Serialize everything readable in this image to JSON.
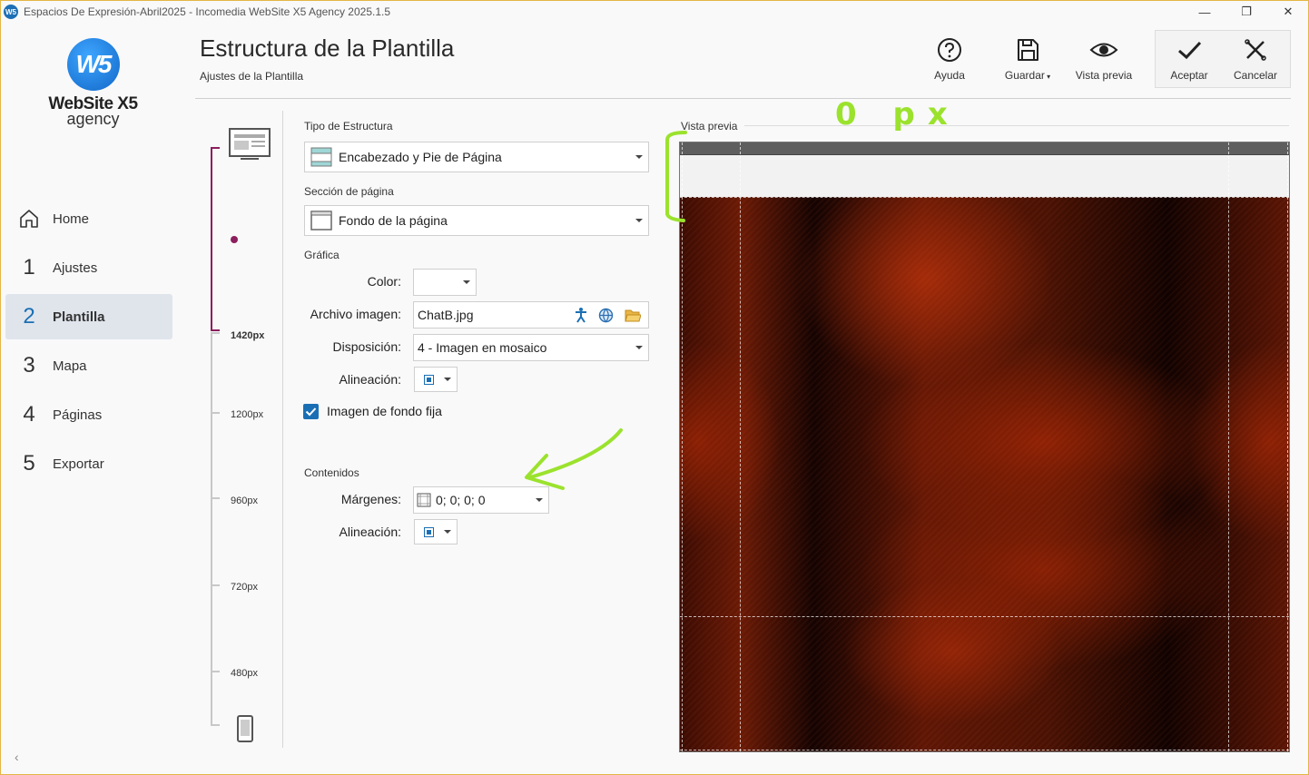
{
  "window": {
    "title": "Espacios De Expresión-Abril2025 - Incomedia WebSite X5 Agency 2025.1.5",
    "icon_label": "W5"
  },
  "logo": {
    "line1": "WebSite X5",
    "line2": "agency",
    "mark": "W5"
  },
  "nav": {
    "items": [
      {
        "num": "",
        "label": "Home",
        "icon": "home-icon"
      },
      {
        "num": "1",
        "label": "Ajustes"
      },
      {
        "num": "2",
        "label": "Plantilla",
        "active": true
      },
      {
        "num": "3",
        "label": "Mapa"
      },
      {
        "num": "4",
        "label": "Páginas"
      },
      {
        "num": "5",
        "label": "Exportar"
      }
    ],
    "collapse_glyph": "‹"
  },
  "header": {
    "title": "Estructura de la Plantilla",
    "subtitle": "Ajustes de la Plantilla"
  },
  "toolbar": {
    "help": "Ayuda",
    "save": "Guardar",
    "preview": "Vista previa",
    "accept": "Aceptar",
    "cancel": "Cancelar"
  },
  "resolutions": {
    "current": "1420px",
    "r1200": "1200px",
    "r960": "960px",
    "r720": "720px",
    "r480": "480px"
  },
  "form": {
    "structure_type": {
      "title": "Tipo de Estructura",
      "value": "Encabezado y Pie de Página"
    },
    "page_section": {
      "title": "Sección de página",
      "value": "Fondo de la página"
    },
    "graphics": {
      "title": "Gráfica",
      "color_label": "Color:",
      "image_label": "Archivo imagen:",
      "image_value": "ChatB.jpg",
      "layout_label": "Disposición:",
      "layout_value": "4 - Imagen en mosaico",
      "align_label": "Alineación:",
      "fixed_label": "Imagen de fondo fija",
      "fixed_checked": true
    },
    "contents": {
      "title": "Contenidos",
      "margins_label": "Márgenes:",
      "margins_value": "0; 0; 0; 0",
      "align_label": "Alineación:"
    }
  },
  "preview": {
    "title": "Vista previa"
  },
  "annotation": {
    "text": "0 px",
    "color": "#9be22d"
  },
  "colors": {
    "accent": "#1a6fb4",
    "rail_active": "#8c1f5e",
    "window_border": "#e6b645"
  }
}
